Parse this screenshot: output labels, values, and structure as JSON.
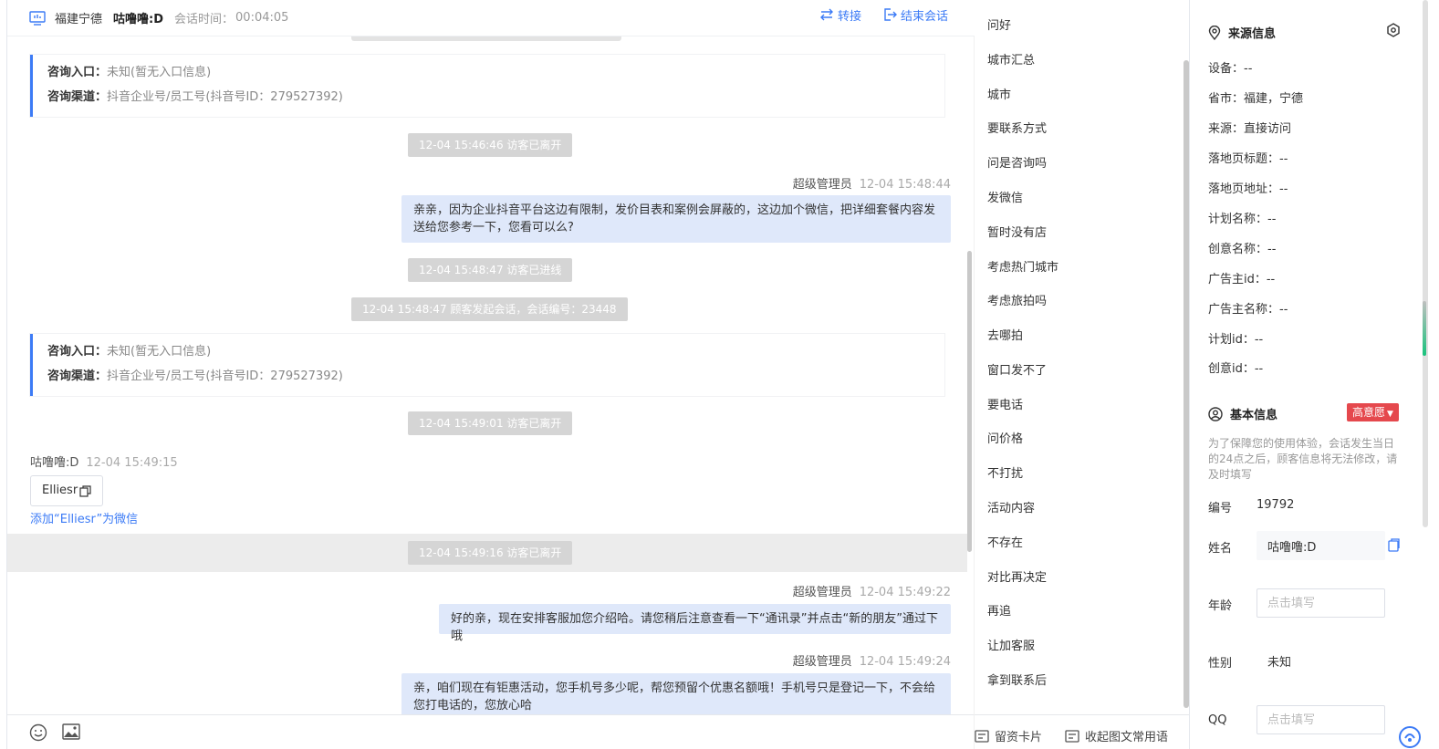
{
  "header": {
    "region": "福建宁德",
    "visitor_name": "咕噜噜:D",
    "duration_label": "会话时间：",
    "duration_value": "00:04:05",
    "transfer_label": "转接",
    "end_label": "结束会话"
  },
  "messages": {
    "card1": {
      "entry_key": "咨询入口：",
      "entry_value": "未知(暂无入口信息)",
      "channel_key": "咨询渠道：",
      "channel_value": "抖音企业号/员工号(抖音号ID：279527392)"
    },
    "sys1": "12-04 15:46:46 访客已离开",
    "agent1_name": "超级管理员",
    "agent1_time": "12-04 15:48:44",
    "agent1_text_line1": "亲亲，因为企业抖音平台这边有限制，发价目表和案例会屏蔽的，这边加个微信，把详细套餐内容发",
    "agent1_text_line2": "送给您参考一下，您看可以么?",
    "sys2": "12-04 15:48:47 访客已进线",
    "sys3": "12-04 15:48:47 顾客发起会话，会话编号：23448",
    "card2": {
      "entry_key": "咨询入口：",
      "entry_value": "未知(暂无入口信息)",
      "channel_key": "咨询渠道：",
      "channel_value": "抖音企业号/员工号(抖音号ID：279527392)"
    },
    "sys4": "12-04 15:49:01 访客已离开",
    "visitor_name": "咕噜噜:D",
    "visitor_time": "12-04 15:49:15",
    "visitor_text": "Elliesr",
    "add_wechat": "添加“Elliesr”为微信",
    "sys5": "12-04 15:49:16 访客已离开",
    "agent2_name": "超级管理员",
    "agent2_time": "12-04 15:49:22",
    "agent2_text": "好的亲，现在安排客服加您介绍哈。请您稍后注意查看一下“通讯录”并点击“新的朋友”通过下哦",
    "agent3_name": "超级管理员",
    "agent3_time": "12-04 15:49:24",
    "agent3_text_line1": "亲，咱们现在有钜惠活动，您手机号多少呢，帮您预留个优惠名额哦！手机号只是登记一下，不会给",
    "agent3_text_line2": "您打电话的，您放心哈"
  },
  "toolbar": {
    "emoji_icon": "smile-icon",
    "image_icon": "image-icon"
  },
  "phrases": {
    "items": [
      "问好",
      "城市汇总",
      "城市",
      "要联系方式",
      "问是咨询吗",
      "发微信",
      "暂时没有店",
      "考虑热门城市",
      "考虑旅拍吗",
      "去哪拍",
      "窗口发不了",
      "要电话",
      "问价格",
      "不打扰",
      "活动内容",
      "不存在",
      "对比再决定",
      "再追",
      "让加客服",
      "拿到联系后"
    ],
    "card_btn": "留资卡片",
    "collapse_btn": "收起图文常用语"
  },
  "source": {
    "title": "来源信息",
    "rows": [
      "设备：--",
      "省市：福建，宁德",
      "来源：直接访问",
      "落地页标题：--",
      "落地页地址：--",
      "计划名称：--",
      "创意名称：--",
      "广告主id：--",
      "广告主名称：--",
      "计划id：--",
      "创意id：--"
    ]
  },
  "basic": {
    "title": "基本信息",
    "intent_badge": "高意愿",
    "note": "为了保障您的使用体验，会话发生当日的24点之后，顾客信息将无法修改，请及时填写",
    "id_label": "编号",
    "id_value": "19792",
    "name_label": "姓名",
    "name_value": "咕噜噜:D",
    "age_label": "年龄",
    "age_placeholder": "点击填写",
    "gender_label": "性别",
    "gender_value": "未知",
    "qq_label": "QQ",
    "qq_placeholder": "点击填写"
  },
  "colors": {
    "accent": "#3c7bf6",
    "badge": "#e5484d",
    "agent_bubble": "#dfe8fa",
    "system_pill": "#d5d5d5"
  }
}
